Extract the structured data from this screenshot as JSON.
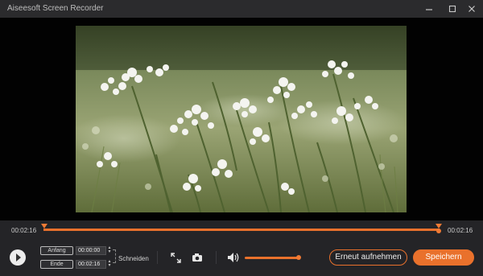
{
  "window": {
    "title": "Aiseesoft Screen Recorder",
    "controls": [
      "minimize-icon",
      "maximize-icon",
      "close-icon"
    ]
  },
  "timeline": {
    "current_time": "00:02:16",
    "total_time": "00:02:16",
    "progress": 1.0
  },
  "trim": {
    "start_label": "Anfang",
    "start_value": "00:00:00",
    "end_label": "Ende",
    "end_value": "00:02:16",
    "cut_label": "Schneiden"
  },
  "tools": {
    "expand_icon": "expand-icon",
    "snapshot_icon": "camera-icon",
    "volume_icon": "speaker-icon",
    "volume_level": 1.0
  },
  "actions": {
    "rerecord_label": "Erneut aufnehmen",
    "save_label": "Speichern"
  },
  "colors": {
    "accent": "#e9712c",
    "titlebar": "#2b2b2d",
    "panel": "#242427"
  }
}
